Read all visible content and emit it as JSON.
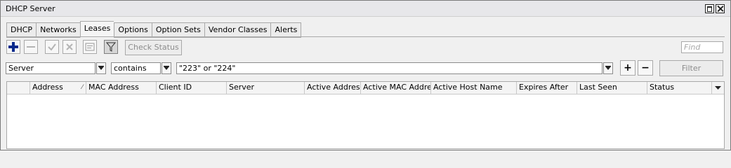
{
  "window": {
    "title": "DHCP Server"
  },
  "tabs": [
    {
      "label": "DHCP",
      "active": false
    },
    {
      "label": "Networks",
      "active": false
    },
    {
      "label": "Leases",
      "active": true
    },
    {
      "label": "Options",
      "active": false
    },
    {
      "label": "Option Sets",
      "active": false
    },
    {
      "label": "Vendor Classes",
      "active": false
    },
    {
      "label": "Alerts",
      "active": false
    }
  ],
  "toolbar": {
    "buttons": [
      "add-icon",
      "remove-icon",
      "enable-icon",
      "disable-icon",
      "comment-icon",
      "filter-icon"
    ],
    "check_status_label": "Check Status",
    "find_placeholder": "Find"
  },
  "filter": {
    "field": "Server",
    "operator": "contains",
    "value": "\"223\" or \"224\"",
    "add_label": "+",
    "remove_label": "−",
    "filter_label": "Filter"
  },
  "table": {
    "columns": [
      "",
      "Address",
      "MAC Address",
      "Client ID",
      "Server",
      "Active Address",
      "Active MAC Addre...",
      "Active Host Name",
      "Expires After",
      "Last Seen",
      "Status"
    ],
    "sorted_column": "Address",
    "rows": []
  },
  "colors": {
    "accent_blue": "#0a2a8c",
    "disabled_text": "#8c8c8c"
  }
}
